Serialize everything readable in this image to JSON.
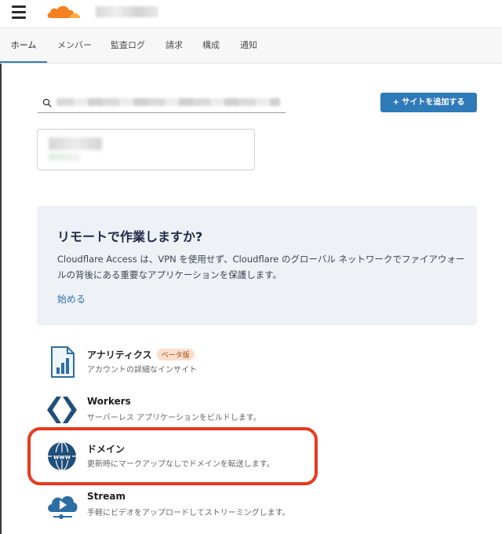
{
  "header": {
    "menu_icon": "hamburger-menu-icon",
    "logo_icon": "cloudflare-cloud-icon"
  },
  "tabs": [
    {
      "label": "ホーム",
      "active": true
    },
    {
      "label": "メンバー"
    },
    {
      "label": "監査ログ"
    },
    {
      "label": "請求"
    },
    {
      "label": "構成"
    },
    {
      "label": "通知"
    }
  ],
  "search": {
    "icon": "search-icon",
    "value": ""
  },
  "add_site_button": {
    "label": "+ サイトを追加する"
  },
  "promo": {
    "title": "リモートで作業しますか?",
    "body": "Cloudflare Access は、VPN を使用せず、Cloudflare のグローバル ネットワークでファイアウォールの背後にある重要なアプリケーションを保護します。",
    "link": "始める"
  },
  "apps": [
    {
      "title": "アナリティクス",
      "badge": "ベータ版",
      "desc": "アカウントの詳細なインサイト",
      "icon": "analytics-chart-icon"
    },
    {
      "title": "Workers",
      "desc": "サーバーレス アプリケーションをビルドします。",
      "icon": "workers-hexagon-icon"
    },
    {
      "title": "ドメイン",
      "desc": "更新時にマークアップなしでドメインを転送します。",
      "icon": "www-globe-icon"
    },
    {
      "title": "Stream",
      "desc": "手軽にビデオをアップロードしてストリーミングします。",
      "icon": "stream-cloud-play-icon"
    }
  ],
  "colors": {
    "accent": "#2f7ab8",
    "highlight": "#e8391d",
    "cloudflare_orange": "#f48120"
  }
}
